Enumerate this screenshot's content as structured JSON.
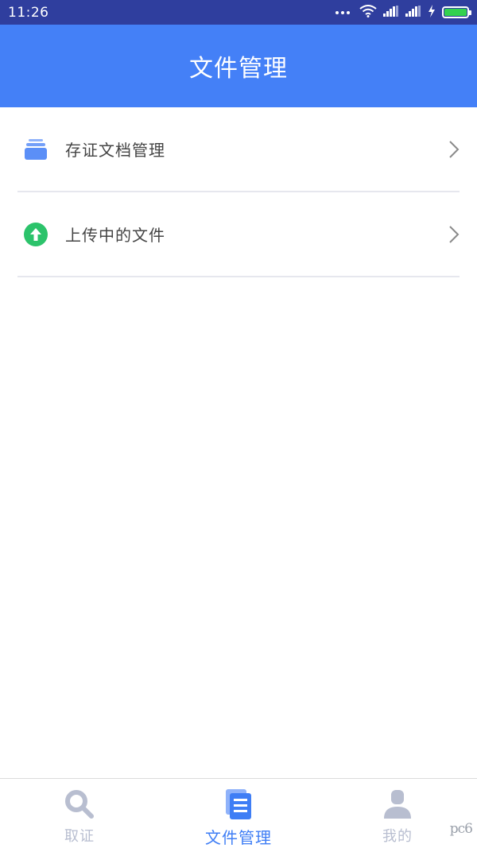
{
  "status_bar": {
    "time": "11:26",
    "icons": [
      "more-dots-icon",
      "wifi-icon",
      "signal-icon",
      "signal-icon",
      "charging-icon",
      "battery-icon"
    ],
    "battery_color": "#33d14f"
  },
  "header": {
    "title": "文件管理",
    "background": "#4480f7"
  },
  "menu": {
    "items": [
      {
        "label": "存证文档管理",
        "icon": "document-stack-icon",
        "icon_color": "#5b8ff7"
      },
      {
        "label": "上传中的文件",
        "icon": "upload-arrow-icon",
        "icon_color": "#2cc36b"
      }
    ]
  },
  "bottom_nav": {
    "items": [
      {
        "label": "取证",
        "icon": "search-icon",
        "active": false
      },
      {
        "label": "文件管理",
        "icon": "document-list-icon",
        "active": true
      },
      {
        "label": "我的",
        "icon": "user-icon",
        "active": false
      }
    ],
    "active_color": "#3f7ef5",
    "inactive_color": "#b8bed0"
  },
  "watermark": "pc6"
}
